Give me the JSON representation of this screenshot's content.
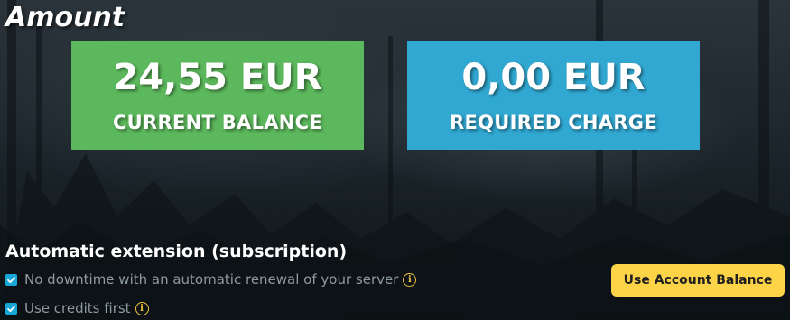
{
  "page": {
    "title": "Amount",
    "background": "dark-forest-image"
  },
  "cards": {
    "current": {
      "amount": "24,55 EUR",
      "label": "CURRENT BALANCE",
      "color": "#5cb85c"
    },
    "required": {
      "amount": "0,00 EUR",
      "label": "REQUIRED CHARGE",
      "color": "#31a8d2"
    }
  },
  "subscription": {
    "heading": "Automatic extension (subscription)",
    "options": [
      {
        "label": "No downtime with an automatic renewal of your server",
        "checked": true,
        "icon": "info-icon"
      },
      {
        "label": "Use credits first",
        "checked": true,
        "icon": "info-icon"
      }
    ]
  },
  "actions": {
    "use_balance_label": "Use Account Balance",
    "button_color": "#fdd447"
  }
}
